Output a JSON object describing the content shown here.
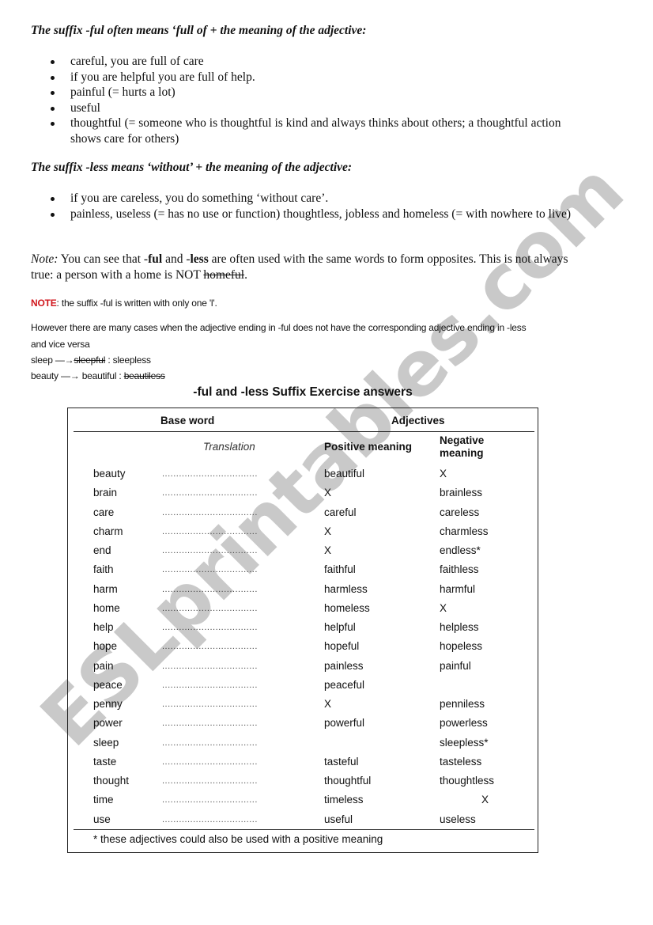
{
  "watermark": "ESLprintables.com",
  "section_ful": {
    "heading": "The suffix -ful often means ‘full of + the meaning of the adjective:",
    "bullets": [
      "careful, you are full of care",
      "if you are helpful you are full of help.",
      "painful (= hurts a lot)",
      "useful",
      "thoughtful (= someone who is thoughtful is kind and always thinks about others; a thoughtful action shows care for others)"
    ]
  },
  "section_less": {
    "heading": "The suffix -less means ‘without’ + the meaning of the adjective:",
    "bullets": [
      "if you are careless, you do something ‘without care’.",
      "painless, useless (= has no use or function) thoughtless, jobless and homeless (= with nowhere to live)"
    ]
  },
  "note_para": {
    "label": "Note:",
    "text_1": " You can see that -",
    "bold_1": "ful",
    "text_2": " and -",
    "bold_2": "less",
    "text_3": " are often used with the same words to form opposites. This is not always true: a person with a home is NOT ",
    "struck": "homeful",
    "text_4": "."
  },
  "note_small": {
    "label": "NOTE",
    "text": ": the suffix -ful is written with only one 'l'.",
    "label_color": "#d0161c"
  },
  "however": {
    "line_1": "However there are many cases when the adjective ending in -ful does not have the corresponding adjective ending in -less",
    "line_2": "and vice versa"
  },
  "examples": [
    {
      "base": "sleep ",
      "arrow": "—→",
      "struck_1": "sleepful",
      "mid": " : sleepless",
      "struck_2": ""
    },
    {
      "base": "beauty ",
      "arrow": "—→",
      "struck_1": "",
      "mid": " beautiful : ",
      "struck_2": "beautiless"
    }
  ],
  "table": {
    "title": "-ful and -less Suffix Exercise answers",
    "header_base": "Base word",
    "header_adjectives": "Adjectives",
    "header_translation": "Translation",
    "header_positive": "Positive meaning",
    "header_negative": "Negative meaning",
    "rows": [
      {
        "base": "beauty",
        "translation": "..................................",
        "positive": "beautiful",
        "negative": "X"
      },
      {
        "base": "brain",
        "translation": "..................................",
        "positive": "X",
        "negative": "brainless"
      },
      {
        "base": "care",
        "translation": "..................................",
        "positive": "careful",
        "negative": "careless"
      },
      {
        "base": "charm",
        "translation": "..................................",
        "positive": "X",
        "negative": "charmless"
      },
      {
        "base": "end",
        "translation": "..................................",
        "positive": "X",
        "negative": "endless*"
      },
      {
        "base": "faith",
        "translation": "..................................",
        "positive": "faithful",
        "negative": "faithless"
      },
      {
        "base": "harm",
        "translation": "..................................",
        "positive": "harmless",
        "negative": "harmful"
      },
      {
        "base": "home",
        "translation": "..................................",
        "positive": "homeless",
        "negative": "X"
      },
      {
        "base": "help",
        "translation": "..................................",
        "positive": "helpful",
        "negative": "helpless"
      },
      {
        "base": "hope",
        "translation": "..................................",
        "positive": "hopeful",
        "negative": "hopeless"
      },
      {
        "base": "pain",
        "translation": "..................................",
        "positive": "painless",
        "negative": "painful"
      },
      {
        "base": "peace",
        "translation": "..................................",
        "positive": "peaceful",
        "negative": ""
      },
      {
        "base": "penny",
        "translation": "..................................",
        "positive": "X",
        "negative": "penniless"
      },
      {
        "base": "power",
        "translation": "..................................",
        "positive": "powerful",
        "negative": "powerless"
      },
      {
        "base": "sleep",
        "translation": "..................................",
        "positive": "",
        "negative": "sleepless*"
      },
      {
        "base": "taste",
        "translation": "..................................",
        "positive": "tasteful",
        "negative": "tasteless"
      },
      {
        "base": "thought",
        "translation": "..................................",
        "positive": "thoughtful",
        "negative": "thoughtless"
      },
      {
        "base": "time",
        "translation": "..................................",
        "positive": "timeless",
        "negative": "X"
      },
      {
        "base": "use",
        "translation": "..................................",
        "positive": "useful",
        "negative": "useless"
      }
    ],
    "footnote": "* these adjectives could also be used with a positive meaning"
  }
}
